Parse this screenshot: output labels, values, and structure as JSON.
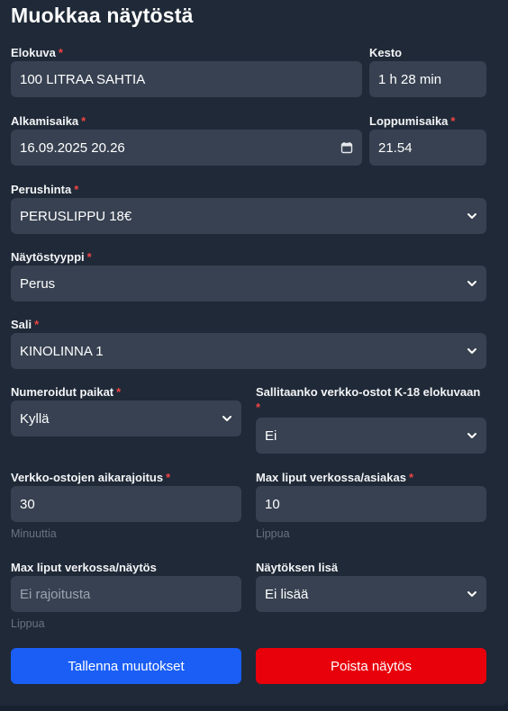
{
  "form": {
    "title": "Muokkaa näytöstä",
    "required_mark": "*",
    "movie": {
      "label": "Elokuva",
      "value": "100 LITRAA SAHTIA"
    },
    "duration": {
      "label": "Kesto",
      "value": "1 h 28 min"
    },
    "start_time": {
      "label": "Alkamisaika",
      "value": "16.09.2025 20.26",
      "icon": "calendar-icon"
    },
    "end_time": {
      "label": "Loppumisaika",
      "value": "21.54"
    },
    "base_price": {
      "label": "Perushinta",
      "value": "PERUSLIPPU 18€",
      "icon": "chevron-down-icon"
    },
    "show_type": {
      "label": "Näytöstyyppi",
      "value": "Perus"
    },
    "hall": {
      "label": "Sali",
      "value": "KINOLINNA 1"
    },
    "numbered_seats": {
      "label": "Numeroidut paikat",
      "value": "Kyllä"
    },
    "k18_online": {
      "label": "Sallitaanko verkko-ostot K-18 elokuvaan",
      "value": "Ei"
    },
    "online_time_limit": {
      "label": "Verkko-ostojen aikarajoitus",
      "value": "30",
      "hint": "Minuuttia"
    },
    "max_per_customer": {
      "label": "Max liput verkossa/asiakas",
      "value": "10",
      "hint": "Lippua"
    },
    "max_per_show": {
      "label": "Max liput verkossa/näytös",
      "placeholder": "Ei rajoitusta",
      "hint": "Lippua"
    },
    "show_extra": {
      "label": "Näytöksen lisä",
      "value": "Ei lisää"
    }
  },
  "actions": {
    "save_label": "Tallenna muutokset",
    "delete_label": "Poista näytös"
  },
  "colors": {
    "background": "#1f2937",
    "field": "#374151",
    "required": "#ef4444",
    "save": "#1a5ef6",
    "delete": "#e8000b"
  }
}
